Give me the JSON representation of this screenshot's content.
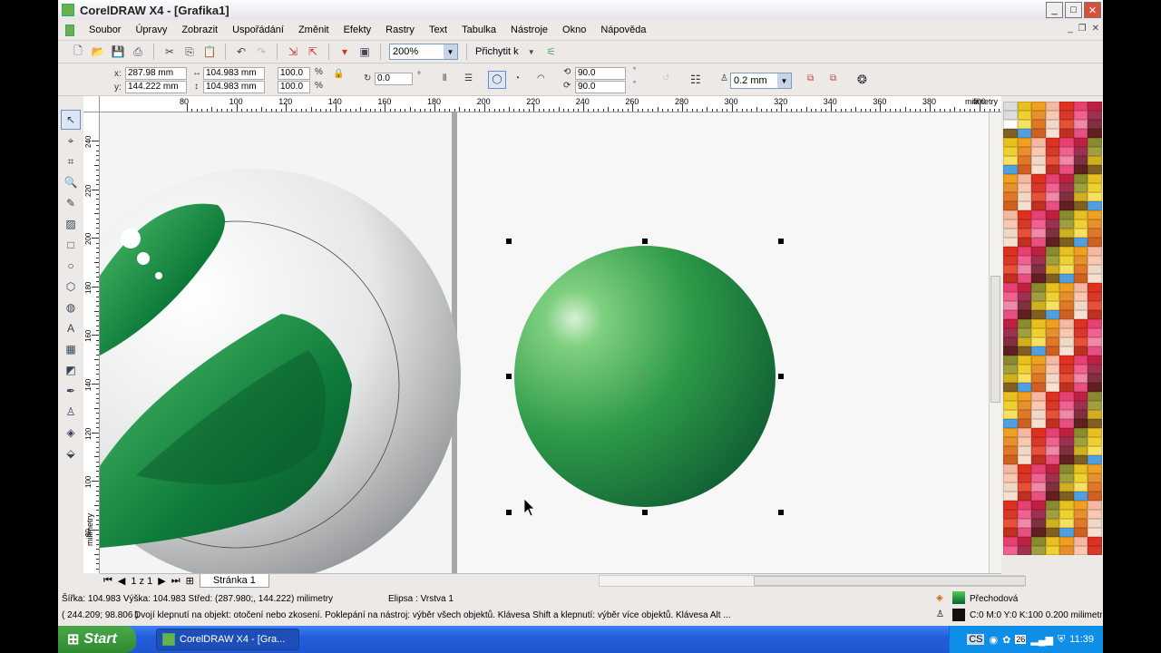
{
  "window": {
    "title": "CorelDRAW X4 - [Grafika1]",
    "min": "_",
    "max": "□",
    "close": "✕"
  },
  "menu": [
    "Soubor",
    "Úpravy",
    "Zobrazit",
    "Uspořádání",
    "Změnit",
    "Efekty",
    "Rastry",
    "Text",
    "Tabulka",
    "Nástroje",
    "Okno",
    "Nápověda"
  ],
  "toolbar": {
    "zoom": "200%",
    "snap": "Přichytit k"
  },
  "props": {
    "x": "287.98 mm",
    "y": "144.222 mm",
    "x_label": "x:",
    "y_label": "y:",
    "width": "104.983 mm",
    "height": "104.983 mm",
    "scale_x": "100.0",
    "scale_y": "100.0",
    "pct": "%",
    "rotation": "0.0",
    "deg": "°",
    "start_angle": "90.0",
    "end_angle": "90.0",
    "outline": "0.2 mm"
  },
  "ruler": {
    "unit": "milimetry",
    "h_ticks": [
      "80",
      "100",
      "120",
      "140",
      "160",
      "180",
      "200",
      "220",
      "240",
      "260",
      "280",
      "300",
      "320",
      "340",
      "360",
      "380",
      "400"
    ],
    "v_ticks": [
      "240",
      "220",
      "200",
      "180",
      "160",
      "140",
      "120",
      "100",
      "80"
    ],
    "v_unit": "milimetry"
  },
  "nav": {
    "page_count": "1 z 1",
    "page_tab": "Stránka 1"
  },
  "status": {
    "dims": "Šířka: 104.983  Výška: 104.983  Střed: (287.980;, 144.222)  milimetry",
    "object": "Elipsa : Vrstva 1",
    "coords": "( 244.209; 98.806 )",
    "hint": "Dvojí klepnutí na objekt: otočení nebo zkosení. Poklepání na nástroj: výběr všech objektů. Klávesa Shift a klepnutí: výběr více objektů. Klávesa Alt ...",
    "fill": "Přechodová",
    "outline": "C:0 M:0 Y:0 K:100  0.200 milimetry"
  },
  "taskbar": {
    "start": "Start",
    "task": "CorelDRAW X4 - [Gra...",
    "lang": "CS",
    "clock": "11:39",
    "date_icon": "26"
  },
  "colors": {
    "sphere_light": "#7fd07f",
    "sphere_mid": "#2e9a48",
    "sphere_dark": "#0d5a32",
    "taskbar": "#245edb"
  },
  "palette": [
    [
      "#8a8a30",
      "#e8c020",
      "#f0a020",
      "#f6b8a0",
      "#e03020",
      "#e84070",
      "#c02040"
    ],
    [
      "#a0a040",
      "#f0d030",
      "#e89030",
      "#f8c8b0",
      "#d83828",
      "#f06090",
      "#a03050"
    ],
    [
      "#d0b020",
      "#f8e060",
      "#e07828",
      "#f0d8c8",
      "#e85038",
      "#f088a8",
      "#803040"
    ],
    [
      "#806020",
      "#50a0e0",
      "#d06020",
      "#f8e0d0",
      "#c03020",
      "#e85080",
      "#602020"
    ]
  ]
}
